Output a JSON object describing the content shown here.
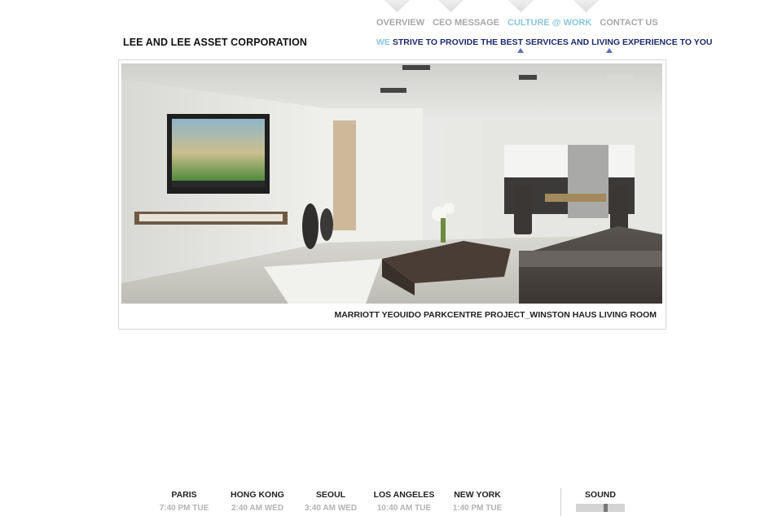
{
  "brand": "LEE AND LEE ASSET CORPORATION",
  "nav": {
    "items": [
      {
        "label": "OVERVIEW",
        "active": false
      },
      {
        "label": "CEO MESSAGE",
        "active": false
      },
      {
        "label": "CULTURE @ WORK",
        "active": true
      },
      {
        "label": "CONTACT US",
        "active": false
      }
    ]
  },
  "tagline": {
    "prefix": "WE",
    "text": " STRIVE TO PROVIDE THE BEST SERVICES AND LIVING EXPERIENCE TO YOU"
  },
  "gallery": {
    "caption": "MARRIOTT YEOUIDO PARKCENTRE PROJECT_WINSTON HAUS LIVING ROOM"
  },
  "clocks": [
    {
      "city": "PARIS",
      "time": "7:40 PM TUE"
    },
    {
      "city": "HONG KONG",
      "time": "2:40 AM WED"
    },
    {
      "city": "SEOUL",
      "time": "3:40 AM WED"
    },
    {
      "city": "LOS ANGELES",
      "time": "10:40 AM TUE"
    },
    {
      "city": "NEW YORK",
      "time": "1:40 PM TUE"
    }
  ],
  "sound": {
    "label": "SOUND",
    "level": 0.62
  },
  "colors": {
    "accent": "#88c7dd",
    "tagline": "#1d2a6b",
    "marker": "#5b6fbf",
    "muted": "#a7a7a7"
  }
}
